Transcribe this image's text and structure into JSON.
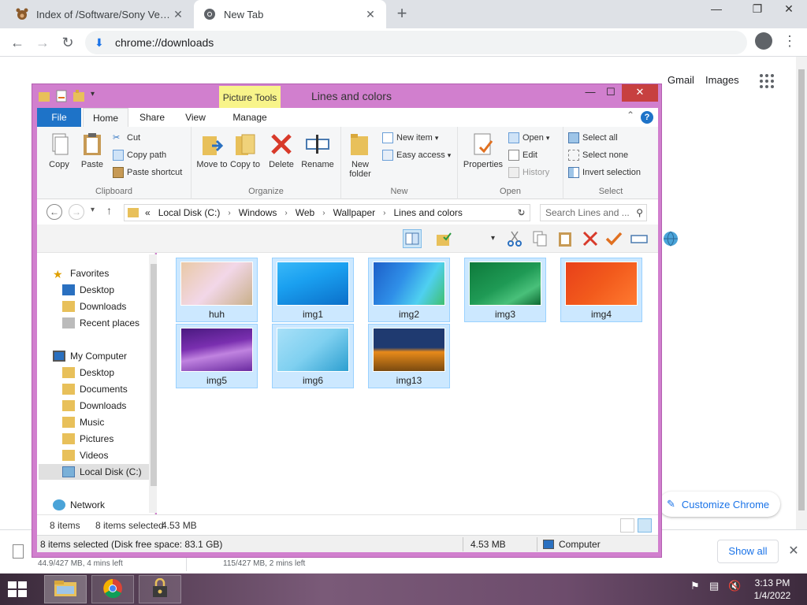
{
  "browser": {
    "tabs": [
      {
        "title": "Index of /Software/Sony Vegas/M",
        "active": false
      },
      {
        "title": "New Tab",
        "active": true
      }
    ],
    "new_tab_symbol": "+",
    "window_controls": {
      "minimize": "—",
      "restore": "❐",
      "close": "✕"
    },
    "omnibox": {
      "url": "chrome://downloads"
    },
    "ntp": {
      "gmail": "Gmail",
      "images": "Images",
      "customize": "Customize Chrome"
    },
    "downloads": [
      {
        "status": "44.9/427 MB, 4 mins left"
      },
      {
        "status": "115/427 MB, 2 mins left"
      }
    ],
    "show_all": "Show all"
  },
  "explorer": {
    "title": "Lines and colors",
    "contextual_tab": "Picture Tools",
    "tabs": [
      "File",
      "Home",
      "Share",
      "View",
      "Manage"
    ],
    "ribbon": {
      "clipboard": {
        "label": "Clipboard",
        "copy": "Copy",
        "paste": "Paste",
        "cut": "Cut",
        "copy_path": "Copy path",
        "paste_shortcut": "Paste shortcut"
      },
      "organize": {
        "label": "Organize",
        "move_to": "Move to",
        "copy_to": "Copy to",
        "delete": "Delete",
        "rename": "Rename"
      },
      "new": {
        "label": "New",
        "new_folder": "New folder",
        "new_item": "New item",
        "easy_access": "Easy access"
      },
      "open": {
        "label": "Open",
        "properties": "Properties",
        "open": "Open",
        "edit": "Edit",
        "history": "History"
      },
      "select": {
        "label": "Select",
        "select_all": "Select all",
        "select_none": "Select none",
        "invert_selection": "Invert selection"
      }
    },
    "address": {
      "prefix": "«",
      "crumbs": [
        "Local Disk (C:)",
        "Windows",
        "Web",
        "Wallpaper",
        "Lines and colors"
      ],
      "search_placeholder": "Search Lines and ..."
    },
    "nav": {
      "favorites": "Favorites",
      "favorites_items": [
        "Desktop",
        "Downloads",
        "Recent places"
      ],
      "computer": "My Computer",
      "computer_items": [
        "Desktop",
        "Documents",
        "Downloads",
        "Music",
        "Pictures",
        "Videos",
        "Local Disk (C:)"
      ],
      "network": "Network"
    },
    "files": [
      {
        "name": "huh",
        "colors": [
          "#e9c9a6",
          "#c9b08a"
        ]
      },
      {
        "name": "img1",
        "colors": [
          "#1aa0f0",
          "#0b6fc9"
        ]
      },
      {
        "name": "img2",
        "colors": [
          "#2f8fe8",
          "#4fd0f0"
        ]
      },
      {
        "name": "img3",
        "colors": [
          "#1f9a55",
          "#0e7a3b"
        ]
      },
      {
        "name": "img4",
        "colors": [
          "#f25a1c",
          "#d63a10"
        ]
      },
      {
        "name": "img5",
        "colors": [
          "#7a2fb0",
          "#c083e0"
        ]
      },
      {
        "name": "img6",
        "colors": [
          "#7fd0f0",
          "#2d9fd0"
        ]
      },
      {
        "name": "img13",
        "colors": [
          "#1f3a70",
          "#e88a1a"
        ]
      }
    ],
    "status": {
      "count": "8 items",
      "selected": "8 items selected",
      "size": "4.53 MB"
    },
    "details": {
      "selection": "8 items selected (Disk free space: 83.1 GB)",
      "size": "4.53 MB",
      "location": "Computer"
    }
  },
  "taskbar": {
    "time": "3:13 PM",
    "date": "1/4/2022"
  }
}
